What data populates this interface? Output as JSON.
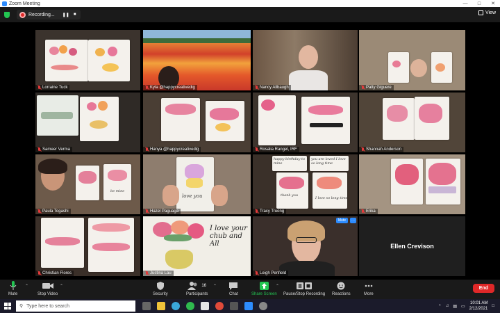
{
  "window": {
    "title": "Zoom Meeting"
  },
  "topbar": {
    "recording_label": "Recording...",
    "view_label": "View"
  },
  "participants": [
    {
      "name": "Lorraine Tuck"
    },
    {
      "name": "Kyla @happycreativedig"
    },
    {
      "name": "Nancy Allbaugh"
    },
    {
      "name": "Patty Giguere"
    },
    {
      "name": "Sameer Verma"
    },
    {
      "name": "Hanya @happycreativedig"
    },
    {
      "name": "Rosalia Rangel, IRF"
    },
    {
      "name": "Shannah Anderson"
    },
    {
      "name": "Paula Togashi"
    },
    {
      "name": "Hazel Paguaga"
    },
    {
      "name": "Tracy Truong"
    },
    {
      "name": "Erika"
    },
    {
      "name": "Christian Flores"
    },
    {
      "name": "Justina Lau"
    },
    {
      "name": "Leigh Penfield"
    },
    {
      "name": "Ellen Crevison"
    }
  ],
  "tile_tags": {
    "mute": "Mute",
    "more": "⋯"
  },
  "card_text": {
    "hazel": "love you",
    "tracy_top_left": "happy birthday to mine",
    "tracy_top_right": "you are loved I love so long time",
    "tracy_card1": "thank you",
    "tracy_card2": "I love so long time",
    "paula_card": "be mine",
    "justina": "I love your chub and All"
  },
  "toolbar": {
    "mute": "Mute",
    "stop_video": "Stop Video",
    "security": "Security",
    "participants": "Participants",
    "participants_count": "16",
    "chat": "Chat",
    "share_screen": "Share Screen",
    "pause_stop_recording": "Pause/Stop Recording",
    "reactions": "Reactions",
    "more": "More",
    "end": "End"
  },
  "taskbar": {
    "search_placeholder": "Type here to search",
    "time": "10:01 AM",
    "date": "2/12/2021"
  },
  "colors": {
    "accent": "#2d8cff",
    "end": "#e02828",
    "share": "#23c552",
    "active_speaker": "#e8e35a"
  }
}
